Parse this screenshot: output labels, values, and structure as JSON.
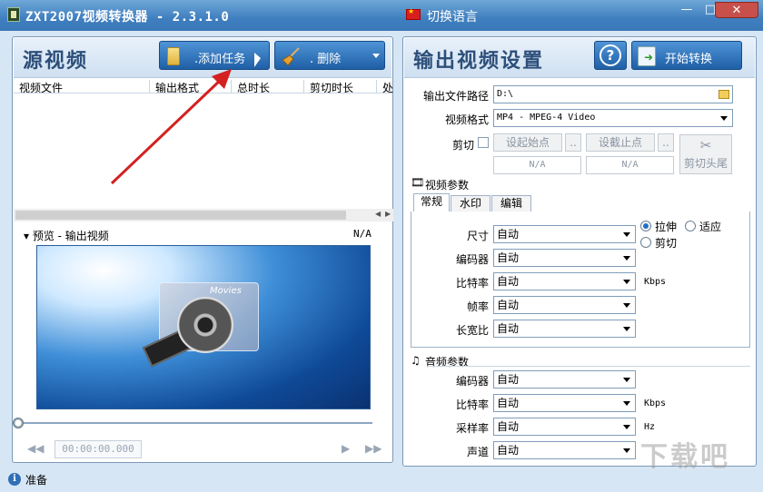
{
  "window": {
    "title": "ZXT2007视频转换器 - 2.3.1.0",
    "language_label": "切换语言",
    "minimize": "—",
    "maximize": "□",
    "close": "✕"
  },
  "source": {
    "title": "源视频",
    "add_task_label": ".添加任务",
    "delete_label": ".  删除",
    "columns": [
      "视频文件",
      "输出格式",
      "总时长",
      "剪切时长",
      "处"
    ],
    "preview_label": "▾ 预览 - 输出视频",
    "preview_value": "N/A",
    "preview_card_label": "Movies",
    "time_display": "00:00:00.000"
  },
  "output": {
    "title": "输出视频设置",
    "help_label": "?",
    "convert_label": "开始转换",
    "path_label": "输出文件路径",
    "path_value": "D:\\",
    "format_label": "视频格式",
    "format_value": "MP4 - MPEG-4 Video",
    "cut_label": "剪切",
    "set_start_label": "设起始点",
    "set_end_label": "设截止点",
    "ellipsis": "..",
    "start_value": "N/A",
    "end_value": "N/A",
    "cut_ends_label": "剪切头尾",
    "video_params_label": "视频参数",
    "tabs": [
      "常规",
      "水印",
      "编辑"
    ],
    "video_fields": [
      {
        "label": "尺寸",
        "value": "自动"
      },
      {
        "label": "编码器",
        "value": "自动"
      },
      {
        "label": "比特率",
        "value": "自动"
      },
      {
        "label": "帧率",
        "value": "自动"
      },
      {
        "label": "长宽比",
        "value": "自动"
      }
    ],
    "bitrate_unit": "Kbps",
    "scale_options": [
      "拉伸",
      "适应",
      "剪切"
    ],
    "audio_params_label": "音频参数",
    "audio_fields": [
      {
        "label": "编码器",
        "value": "自动"
      },
      {
        "label": "比特率",
        "value": "自动"
      },
      {
        "label": "采样率",
        "value": "自动"
      },
      {
        "label": "声道",
        "value": "自动"
      }
    ],
    "audio_bitrate_unit": "Kbps",
    "samplerate_unit": "Hz"
  },
  "status": {
    "text": "准备"
  },
  "watermark": "下载吧",
  "colors": {
    "titlebar": "#3f7fbf",
    "button_blue": "#1f5fa6",
    "annotation_red": "#d42020"
  }
}
